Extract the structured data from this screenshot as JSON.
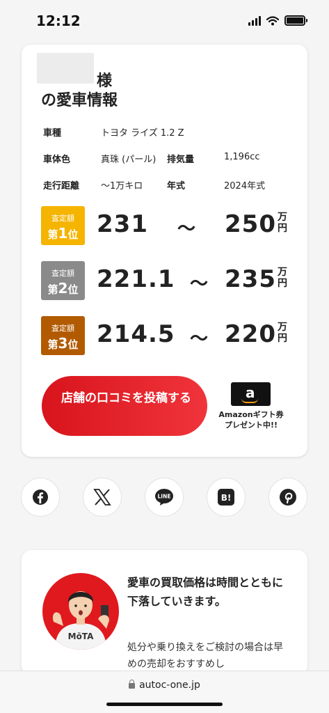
{
  "status_bar": {
    "time": "12:12",
    "icons": [
      "signal-icon",
      "wifi-icon",
      "battery-icon"
    ]
  },
  "card": {
    "honorific": "様",
    "title": "の愛車情報",
    "specs": [
      {
        "label": "車種",
        "value": "トヨタ ライズ 1.2 Z"
      },
      {
        "label": "車体色",
        "value": "真珠 (パール)"
      },
      {
        "label": "排気量",
        "value": "1,196cc"
      },
      {
        "label": "走行距離",
        "value": "〜1万キロ"
      },
      {
        "label": "年式",
        "value": "2024年式"
      }
    ],
    "ranks": [
      {
        "caption": "査定額",
        "prefix": "第",
        "number": "1",
        "suffix": "位",
        "low": "231",
        "tilde": "〜",
        "high": "250",
        "unit": "万円",
        "color": "#f5b400"
      },
      {
        "caption": "査定額",
        "prefix": "第",
        "number": "2",
        "suffix": "位",
        "low": "221.1",
        "tilde": "〜",
        "high": "235",
        "unit": "万円",
        "color": "#8a8a8a"
      },
      {
        "caption": "査定額",
        "prefix": "第",
        "number": "3",
        "suffix": "位",
        "low": "214.5",
        "tilde": "〜",
        "high": "220",
        "unit": "万円",
        "color": "#b25a00"
      }
    ],
    "review_button": "店舗の口コミを投稿する",
    "amazon": {
      "logo": "a",
      "text_line1": "Amazonギフト券",
      "text_line2": "プレゼント中!!"
    }
  },
  "share": [
    {
      "name": "facebook-icon"
    },
    {
      "name": "x-icon"
    },
    {
      "name": "line-icon",
      "label": "LINE"
    },
    {
      "name": "hatena-bookmark-icon",
      "label": "B!"
    },
    {
      "name": "pinterest-icon"
    }
  ],
  "promo": {
    "shirt_text": "MōTA",
    "headline": "愛車の買取価格は時間とともに下落していきます。",
    "body": "処分や乗り換えをご検討の場合は早めの売却をおすすめし"
  },
  "url_bar": {
    "url": "autoc-one.jp"
  },
  "colors": {
    "accent": "#e0191e",
    "gold": "#f5b400",
    "silver": "#8a8a8a",
    "bronze": "#b25a00"
  }
}
